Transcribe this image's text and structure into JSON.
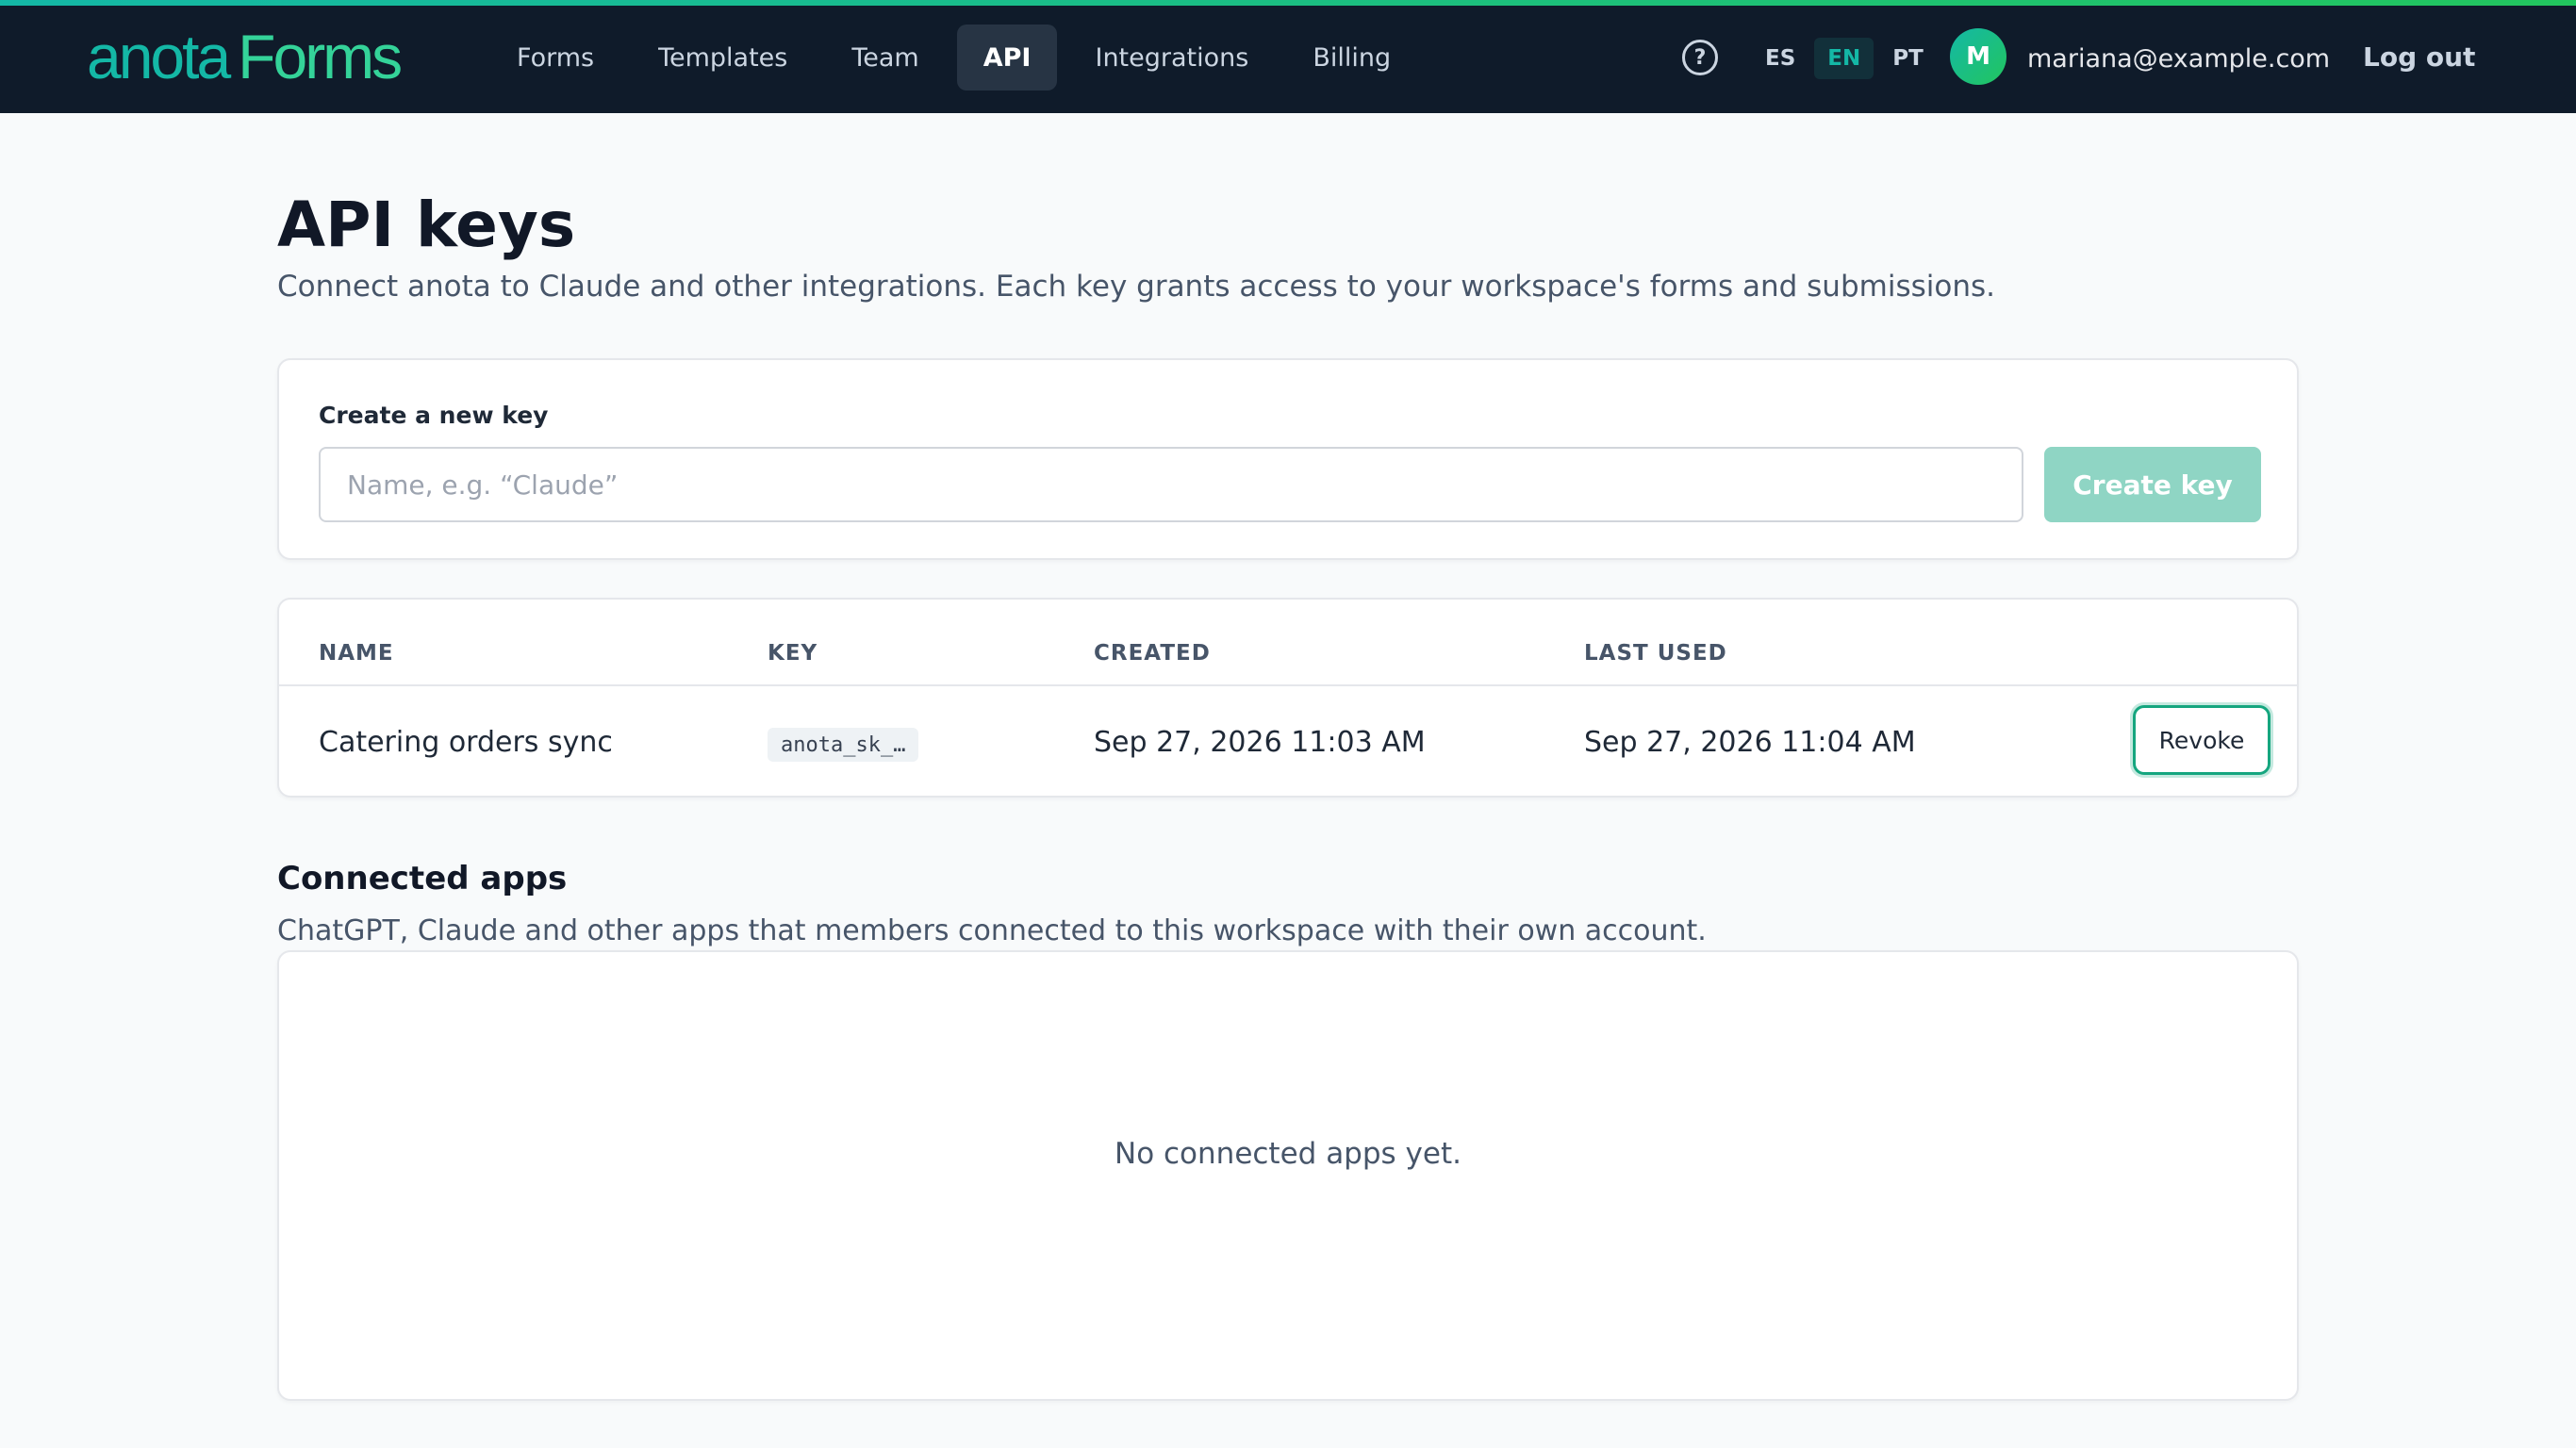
{
  "brand": {
    "part1": "anota",
    "part2": "Forms"
  },
  "nav": {
    "items": [
      {
        "label": "Forms"
      },
      {
        "label": "Templates"
      },
      {
        "label": "Team"
      },
      {
        "label": "API"
      },
      {
        "label": "Integrations"
      },
      {
        "label": "Billing"
      }
    ],
    "active": "API"
  },
  "header": {
    "help_icon": "question-circle-icon",
    "languages": [
      "ES",
      "EN",
      "PT"
    ],
    "active_language": "EN",
    "avatar_initial": "M",
    "user_email": "mariana@example.com",
    "logout_label": "Log out"
  },
  "page": {
    "title": "API keys",
    "subtitle": "Connect anota to Claude and other integrations. Each key grants access to your workspace's forms and submissions."
  },
  "create_key": {
    "label": "Create a new key",
    "input_value": "",
    "placeholder": "Name, e.g. “Claude”",
    "button_label": "Create key"
  },
  "keys_table": {
    "headers": {
      "name": "NAME",
      "key": "KEY",
      "created": "CREATED",
      "last_used": "LAST USED"
    },
    "rows": [
      {
        "name": "Catering orders sync",
        "key": "anota_sk_…",
        "created": "Sep 27, 2026 11:03 AM",
        "last_used": "Sep 27, 2026 11:04 AM",
        "action": "Revoke"
      }
    ]
  },
  "connected_apps": {
    "title": "Connected apps",
    "subtitle": "ChatGPT, Claude and other apps that members connected to this workspace with their own account.",
    "empty_message": "No connected apps yet."
  },
  "colors": {
    "topbar_bg": "#0f1b2a",
    "accent": "#14b8a6",
    "accent_green": "#22c55e",
    "create_button_disabled": "#8fd5c4",
    "revoke_focus_ring": "#15a67f",
    "page_bg": "#f8fafb"
  }
}
